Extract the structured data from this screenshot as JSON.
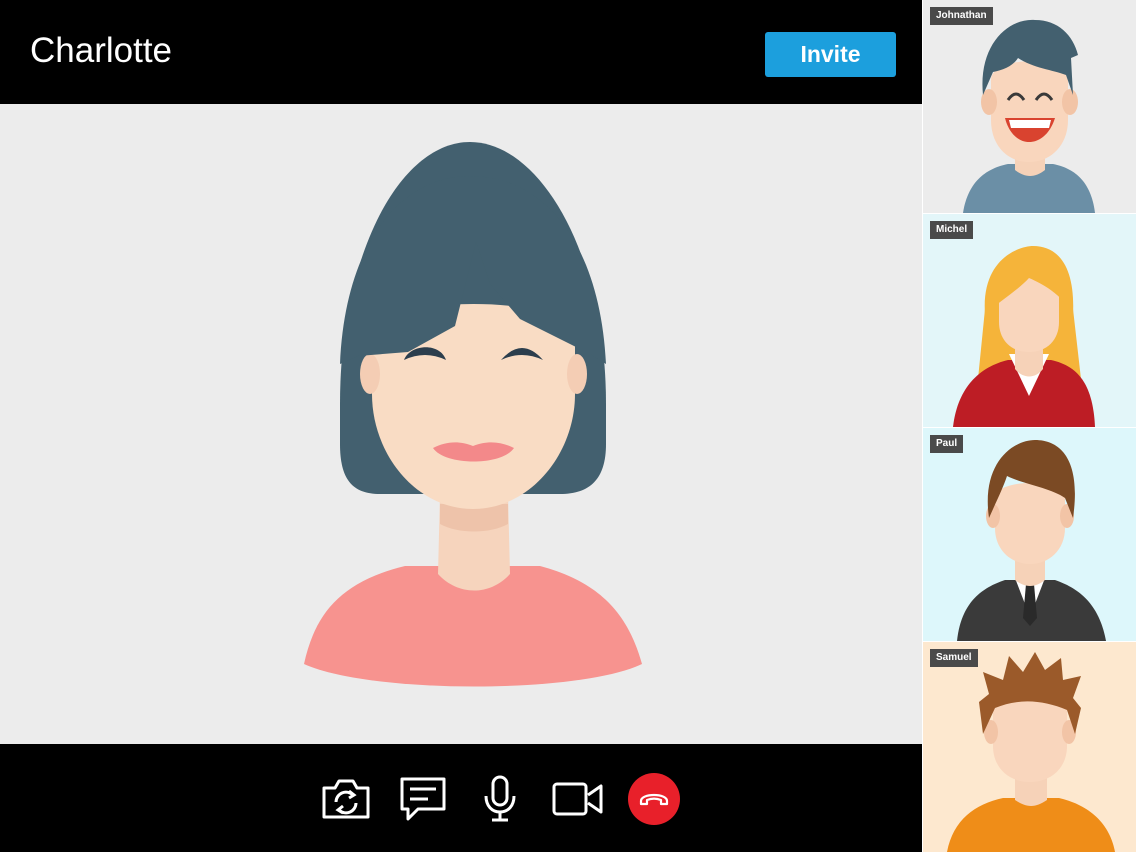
{
  "call": {
    "title": "Charlotte",
    "invite_label": "Invite"
  },
  "controls": [
    {
      "icon": "camera-switch-icon"
    },
    {
      "icon": "chat-icon"
    },
    {
      "icon": "microphone-icon"
    },
    {
      "icon": "video-camera-icon"
    },
    {
      "icon": "end-call-icon",
      "color": "#e8202a"
    }
  ],
  "participants": [
    {
      "name": "Johnathan",
      "background": "#ececec"
    },
    {
      "name": "Michel",
      "background": "#e3f6f9"
    },
    {
      "name": "Paul",
      "background": "#ddf7fb"
    },
    {
      "name": "Samuel",
      "background": "#fde8cf"
    }
  ],
  "colors": {
    "accent": "#1c9fdd",
    "hangup": "#e8202a",
    "bar": "#000000"
  }
}
